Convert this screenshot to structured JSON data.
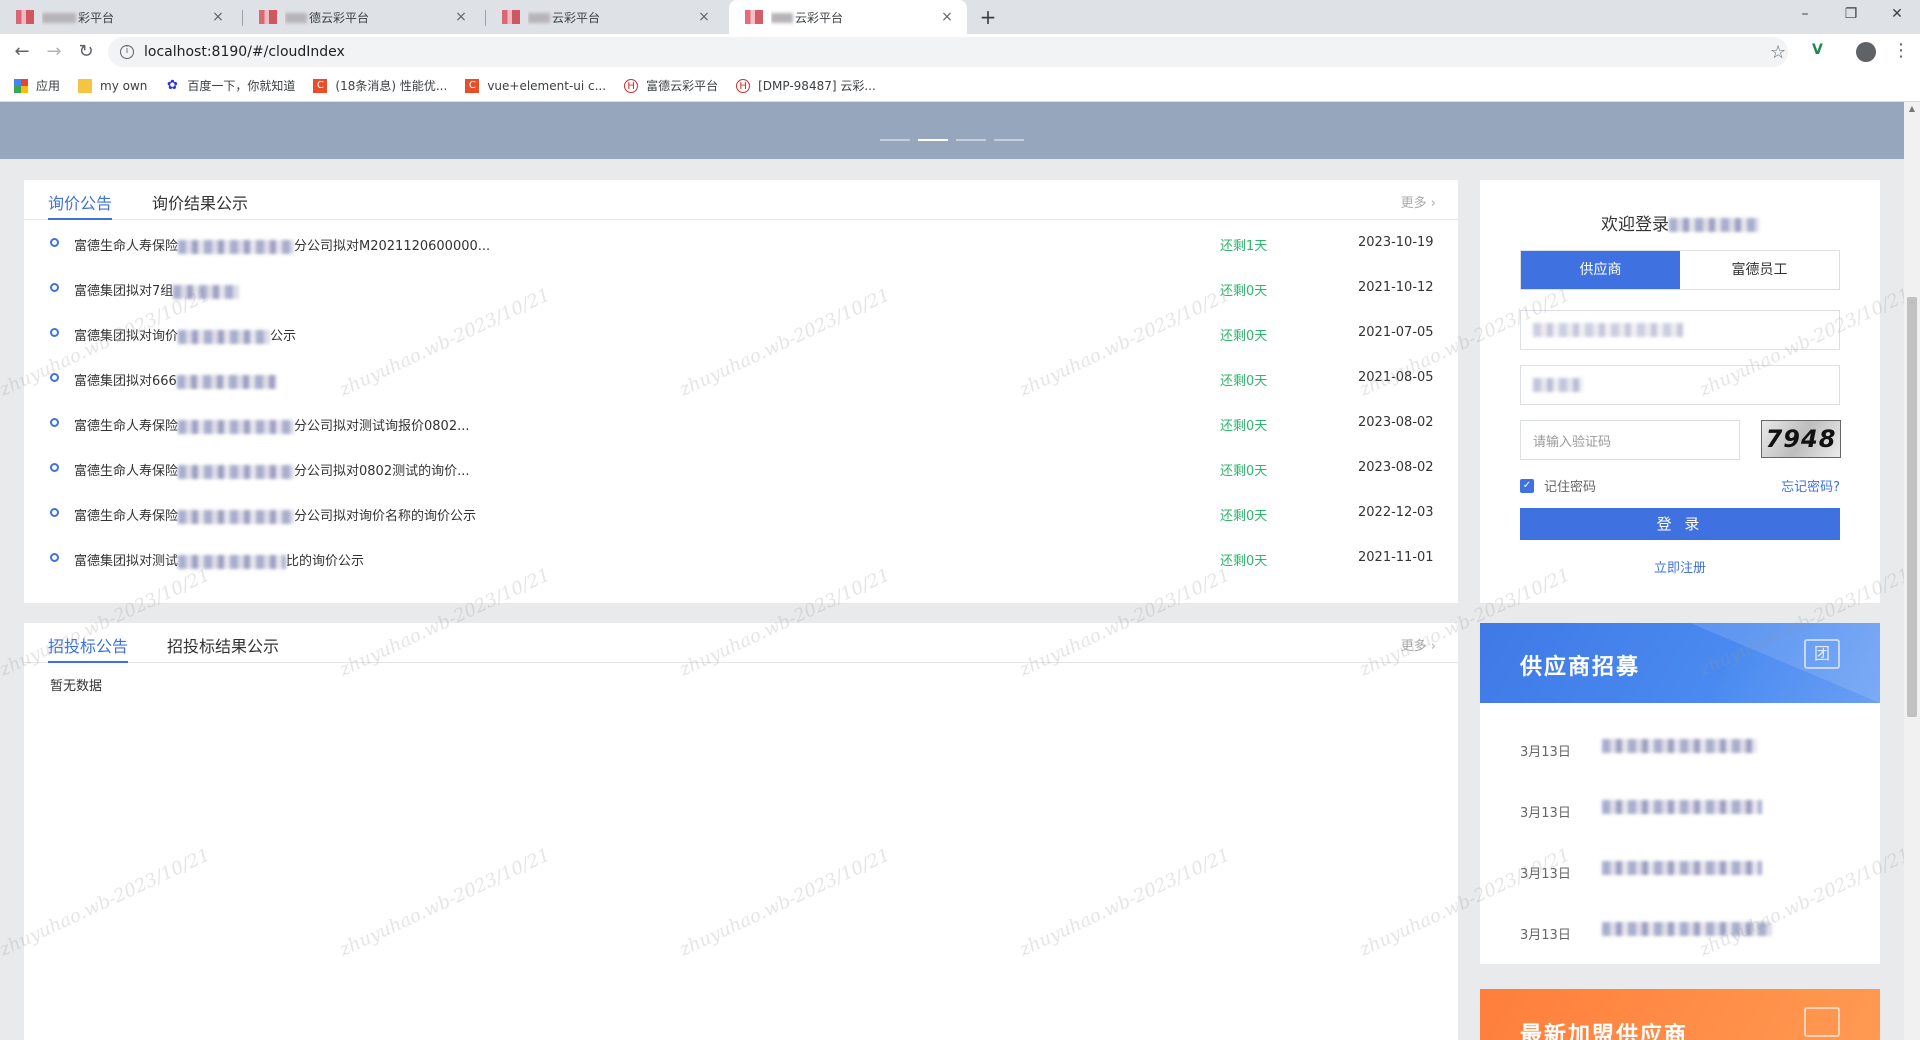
{
  "browser": {
    "tabs": [
      {
        "label": "彩平台",
        "active": false
      },
      {
        "label": "德云彩平台",
        "active": false
      },
      {
        "label": "云彩平台",
        "active": false
      },
      {
        "label": "云彩平台",
        "active": true
      }
    ],
    "tab_close": "×",
    "new_tab": "+",
    "window_controls": [
      "–",
      "❐",
      "✕"
    ],
    "url": "localhost:8190/#/cloudIndex",
    "bookmarks": [
      {
        "label": "应用",
        "icon": "apps-grid-icon"
      },
      {
        "label": "my own",
        "icon": "folder-icon"
      },
      {
        "label": "百度一下，你就知道",
        "icon": "baidu-paw-icon"
      },
      {
        "label": "(18条消息) 性能优...",
        "icon": "csdn-icon"
      },
      {
        "label": "vue+element-ui c...",
        "icon": "csdn-icon"
      },
      {
        "label": "富德云彩平台",
        "icon": "fude-logo-icon"
      },
      {
        "label": "[DMP-98487] 云彩...",
        "icon": "fude-logo-icon"
      }
    ]
  },
  "banner": {
    "slides": 4,
    "active_slide": 2
  },
  "inquiry": {
    "tabs": [
      "询价公告",
      "询价结果公示"
    ],
    "more": "更多",
    "rows": [
      {
        "pre": "富德生命人寿保险",
        "post": "分公司拟对M2021120600000...",
        "remain": "还剩1天",
        "date": "2023-10-19"
      },
      {
        "pre": "富德集团拟对7组",
        "post": "",
        "remain": "还剩0天",
        "date": "2021-10-12"
      },
      {
        "pre": "富德集团拟对询价",
        "post": "公示",
        "remain": "还剩0天",
        "date": "2021-07-05"
      },
      {
        "pre": "富德集团拟对666",
        "post": "",
        "remain": "还剩0天",
        "date": "2021-08-05"
      },
      {
        "pre": "富德生命人寿保险",
        "post": "分公司拟对测试询报价0802...",
        "remain": "还剩0天",
        "date": "2023-08-02"
      },
      {
        "pre": "富德生命人寿保险",
        "post": "分公司拟对0802测试的询价...",
        "remain": "还剩0天",
        "date": "2023-08-02"
      },
      {
        "pre": "富德生命人寿保险",
        "post": "分公司拟对询价名称的询价公示",
        "remain": "还剩0天",
        "date": "2022-12-03"
      },
      {
        "pre": "富德集团拟对测试",
        "post": "比的询价公示",
        "remain": "还剩0天",
        "date": "2021-11-01"
      }
    ]
  },
  "tender": {
    "tabs": [
      "招投标公告",
      "招投标结果公示"
    ],
    "more": "更多",
    "empty_text": "暂无数据"
  },
  "login": {
    "welcome": "欢迎登录",
    "segments": [
      "供应商",
      "富德员工"
    ],
    "captcha_placeholder": "请输入验证码",
    "captcha_text": "7948",
    "remember_label": "记住密码",
    "forgot_label": "忘记密码?",
    "login_button": "登 录",
    "register_link": "立即注册"
  },
  "recruit": {
    "title": "供应商招募",
    "items": [
      {
        "date": "3月13日"
      },
      {
        "date": "3月13日"
      },
      {
        "date": "3月13日"
      },
      {
        "date": "3月13日"
      }
    ]
  },
  "new_suppliers": {
    "title": "最新加盟供应商"
  },
  "watermark": "zhuyuhao.wb-2023/10/21",
  "colors": {
    "accent": "#3f72e0",
    "remain_green": "#2fb66d",
    "banner": "#96a6bd",
    "recruit_blue": "#4a8af0",
    "orange": "#ff8a45"
  }
}
